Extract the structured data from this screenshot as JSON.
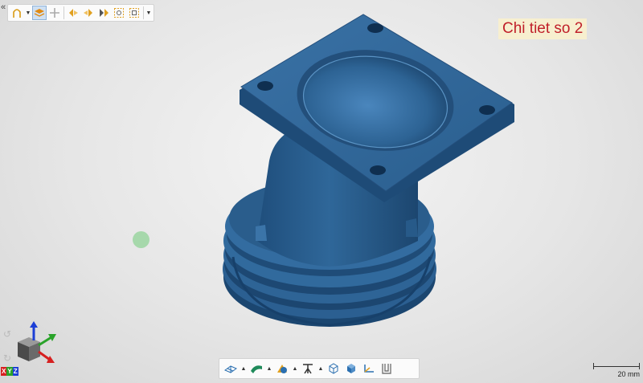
{
  "viewport": {
    "title_label": "Chi tiet so 2",
    "scale_bar_label": "20 mm",
    "part_color": "#2e6395",
    "background_color": "#e8e8e8"
  },
  "top_toolbar": {
    "collapse_glyph": "«",
    "buttons": [
      {
        "name": "selection-mode-icon",
        "active": false
      },
      {
        "name": "layers-icon",
        "active": true
      },
      {
        "name": "move-icon",
        "active": false
      },
      {
        "name": "orient-left-icon",
        "active": false
      },
      {
        "name": "orient-right-icon",
        "active": false
      },
      {
        "name": "orient-flip-icon",
        "active": false
      },
      {
        "name": "zoom-box-icon",
        "active": false
      },
      {
        "name": "zoom-fit-icon",
        "active": false
      }
    ]
  },
  "bottom_toolbar": {
    "buttons": [
      {
        "name": "mesh-display-icon"
      },
      {
        "name": "surface-color-icon"
      },
      {
        "name": "render-mode-icon"
      },
      {
        "name": "measure-icon"
      },
      {
        "name": "wireframe-cube-icon"
      },
      {
        "name": "shaded-cube-icon"
      },
      {
        "name": "coordinate-icon"
      },
      {
        "name": "section-icon"
      }
    ]
  },
  "axis_indicator": {
    "labels": [
      "X",
      "Y",
      "Z"
    ],
    "colors": {
      "x": "#d62020",
      "y": "#2aa32a",
      "z": "#1c3fd6"
    }
  }
}
